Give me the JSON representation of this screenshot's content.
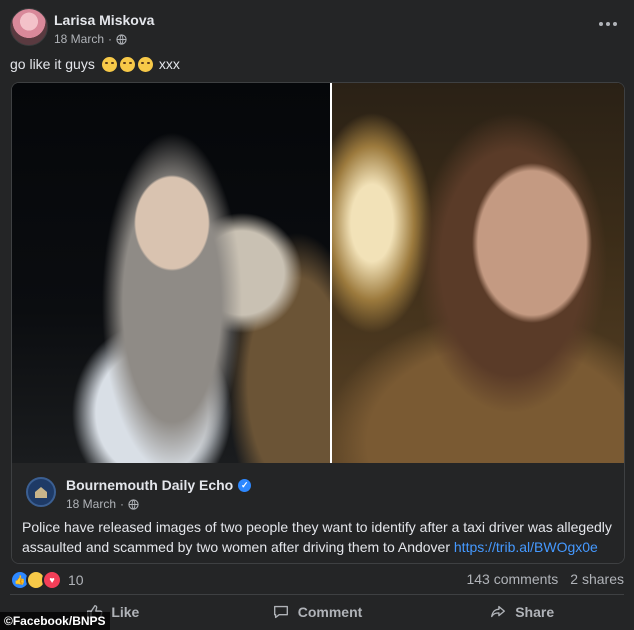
{
  "post": {
    "author": "Larisa Miskova",
    "date": "18 March",
    "caption_text": "go like it guys",
    "caption_tail": "xxx"
  },
  "shared": {
    "page_name": "Bournemouth Daily Echo",
    "date": "18 March",
    "text": "Police have released images of two people they want to identify after a taxi driver was allegedly assaulted and scammed by two women after driving them to Andover",
    "url": "https://trib.al/BWOgx0e"
  },
  "stats": {
    "reaction_count": "10",
    "comments": "143 comments",
    "shares": "2 shares"
  },
  "actions": {
    "like": "Like",
    "comment": "Comment",
    "share": "Share"
  },
  "watermark": "©Facebook/BNPS",
  "icons": {
    "privacy": "globe-icon",
    "menu": "more-options-icon",
    "verified": "verified-badge-icon",
    "reactions": [
      "like-reaction-icon",
      "haha-reaction-icon",
      "love-reaction-icon"
    ]
  },
  "colors": {
    "background": "#242526",
    "text": "#e4e6eb",
    "secondary_text": "#b0b3b8",
    "link": "#4599ff",
    "verified": "#2d88ff"
  }
}
